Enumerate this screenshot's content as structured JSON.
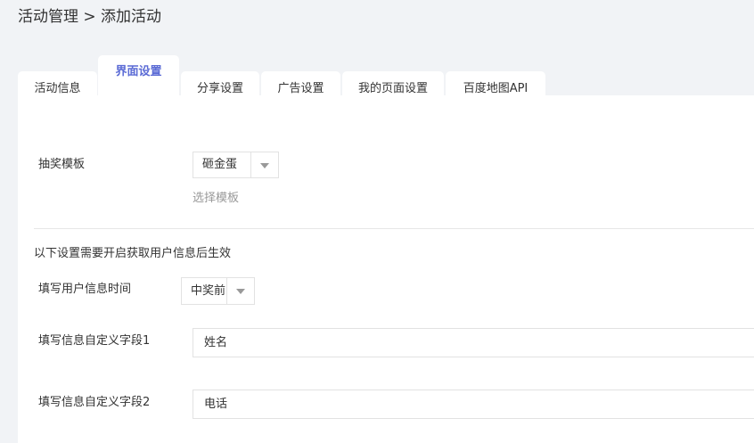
{
  "breadcrumb": "活动管理 > 添加活动",
  "tabs": [
    {
      "label": "活动信息"
    },
    {
      "label": "界面设置"
    },
    {
      "label": "分享设置"
    },
    {
      "label": "广告设置"
    },
    {
      "label": "我的页面设置"
    },
    {
      "label": "百度地图API"
    }
  ],
  "active_tab": "界面设置",
  "accent_color": "#5b6bd5",
  "form": {
    "template_label": "抽奖模板",
    "template_value": "砸金蛋",
    "template_hint": "选择模板",
    "notice": "以下设置需要开启获取用户信息后生效",
    "time_label": "填写用户信息时间",
    "time_value": "中奖前",
    "field1_label": "填写信息自定义字段1",
    "field1_value": "姓名",
    "field2_label": "填写信息自定义字段2",
    "field2_value": "电话"
  },
  "icons": {
    "dropdown": "chevron-down-icon"
  }
}
